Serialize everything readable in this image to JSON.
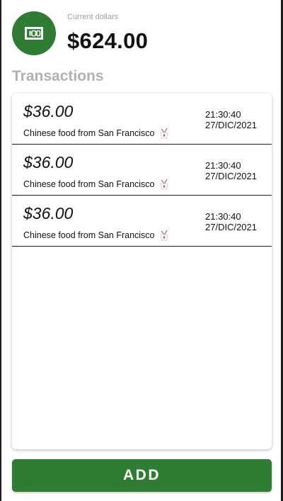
{
  "balance": {
    "caption": "Current dollars",
    "amount": "$624.00",
    "icon": "money-bill-icon"
  },
  "transactions": {
    "title": "Transactions",
    "items": [
      {
        "amount": "$36.00",
        "description": "Chinese food from San Francisco",
        "icon": "takeout-box-icon",
        "time": "21:30:40",
        "date": "27/DIC/2021"
      },
      {
        "amount": "$36.00",
        "description": "Chinese food from San Francisco",
        "icon": "takeout-box-icon",
        "time": "21:30:40",
        "date": "27/DIC/2021"
      },
      {
        "amount": "$36.00",
        "description": "Chinese food from San Francisco",
        "icon": "takeout-box-icon",
        "time": "21:30:40",
        "date": "27/DIC/2021"
      }
    ]
  },
  "actions": {
    "add_label": "ADD"
  },
  "colors": {
    "primary": "#2e7d32",
    "section_title": "#b0b0b0",
    "caption": "#9e9e9e"
  }
}
